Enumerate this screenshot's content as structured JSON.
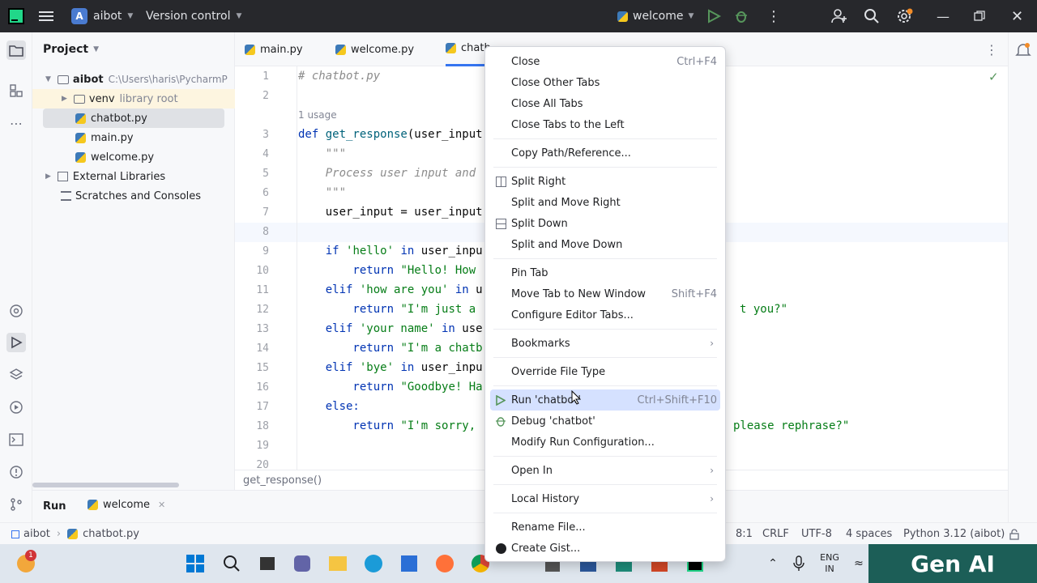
{
  "titlebar": {
    "project_initial": "A",
    "project_name": "aibot",
    "vcs_label": "Version control",
    "run_config": "welcome"
  },
  "project_panel": {
    "title": "Project",
    "root_name": "aibot",
    "root_path": "C:\\Users\\haris\\PycharmP",
    "items": [
      {
        "label": "venv",
        "hint": "library root"
      },
      {
        "label": "chatbot.py"
      },
      {
        "label": "main.py"
      },
      {
        "label": "welcome.py"
      },
      {
        "label": "External Libraries"
      },
      {
        "label": "Scratches and Consoles"
      }
    ]
  },
  "tabs": [
    "main.py",
    "welcome.py",
    "chatb"
  ],
  "editor": {
    "usage_hint": "1 usage",
    "line_numbers": [
      "1",
      "2",
      "3",
      "4",
      "5",
      "6",
      "7",
      "8",
      "9",
      "10",
      "11",
      "12",
      "13",
      "14",
      "15",
      "16",
      "17",
      "18",
      "19",
      "20"
    ],
    "code": {
      "l1": "# chatbot.py",
      "l3a": "def ",
      "l3b": "get_response",
      "l3c": "(user_input",
      "l4": "    \"\"\"",
      "l5": "    Process user input and",
      "l6": "    \"\"\"",
      "l7": "    user_input = user_input",
      "l9a": "    if ",
      "l9b": "'hello'",
      "l9c": " in ",
      "l9d": "user_inpu",
      "l10a": "        return ",
      "l10b": "\"Hello! How",
      "l11a": "    elif ",
      "l11b": "'how are you'",
      "l11c": " in ",
      "l11d": "u",
      "l12a": "        return ",
      "l12b": "\"I'm just a",
      "l12r": "t you?\"",
      "l13a": "    elif ",
      "l13b": "'your name'",
      "l13c": " in ",
      "l13d": "use",
      "l14a": "        return ",
      "l14b": "\"I'm a chatb",
      "l15a": "    elif ",
      "l15b": "'bye'",
      "l15c": " in ",
      "l15d": "user_inpu",
      "l16a": "        return ",
      "l16b": "\"Goodbye! Ha",
      "l17": "    else:",
      "l18a": "        return ",
      "l18b": "\"I'm sorry,",
      "l18r": "please rephrase?\""
    }
  },
  "breadcrumb_function": "get_response()",
  "run_panel": {
    "tab": "Run",
    "config": "welcome"
  },
  "statusbar": {
    "crumb_project": "aibot",
    "crumb_file": "chatbot.py",
    "position": "8:1",
    "line_ending": "CRLF",
    "encoding": "UTF-8",
    "indent": "4 spaces",
    "interpreter": "Python 3.12 (aibot)"
  },
  "context_menu": {
    "close": "Close",
    "close_sc": "Ctrl+F4",
    "close_other": "Close Other Tabs",
    "close_all": "Close All Tabs",
    "close_left": "Close Tabs to the Left",
    "copy_path": "Copy Path/Reference...",
    "split_right": "Split Right",
    "split_move_right": "Split and Move Right",
    "split_down": "Split Down",
    "split_move_down": "Split and Move Down",
    "pin_tab": "Pin Tab",
    "move_tab": "Move Tab to New Window",
    "move_tab_sc": "Shift+F4",
    "configure_tabs": "Configure Editor Tabs...",
    "bookmarks": "Bookmarks",
    "override_type": "Override File Type",
    "run": "Run 'chatbot'",
    "run_sc": "Ctrl+Shift+F10",
    "debug": "Debug 'chatbot'",
    "modify_run": "Modify Run Configuration...",
    "open_in": "Open In",
    "local_history": "Local History",
    "rename": "Rename File...",
    "gist": "Create Gist..."
  },
  "taskbar": {
    "notification_count": "1",
    "lang_line1": "ENG",
    "lang_line2": "IN",
    "watermark": "Gen AI"
  },
  "colors": {
    "titlebar": "#27282c",
    "highlight": "#d5e1ff",
    "run_green": "#4caf50",
    "watermark_bg": "#1c5e57"
  }
}
